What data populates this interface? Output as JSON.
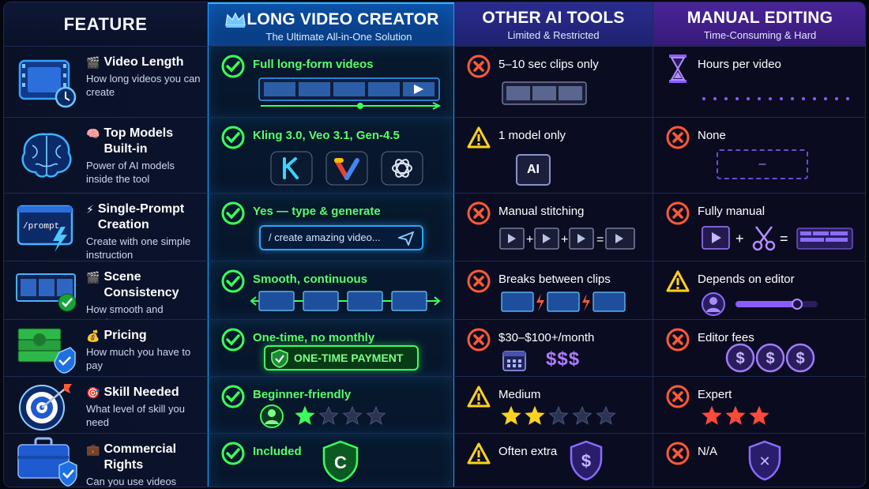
{
  "header": {
    "feature": "FEATURE",
    "long_title": "LONG VIDEO CREATOR",
    "long_sub": "The Ultimate All-in-One Solution",
    "other_title": "OTHER AI TOOLS",
    "other_sub": "Limited & Restricted",
    "manual_title": "MANUAL EDITING",
    "manual_sub": "Time-Consuming & Hard"
  },
  "rows": [
    {
      "feature": {
        "emoji": "🎬",
        "title": "Video Length",
        "desc": "How long videos you can create",
        "icon": "film-clock-icon"
      },
      "long": {
        "status": "check",
        "text": "Full long-form videos"
      },
      "other": {
        "status": "cross",
        "text": "5–10 sec clips only"
      },
      "manual": {
        "status": "hourglass",
        "text": "Hours per video"
      }
    },
    {
      "feature": {
        "emoji": "🧠",
        "title": "Top Models Built-in",
        "desc": "Power of AI models inside the tool",
        "icon": "brain-icon"
      },
      "long": {
        "status": "check",
        "text": "Kling 3.0, Veo 3.1, Gen-4.5"
      },
      "other": {
        "status": "warning",
        "text": "1 model only",
        "chip": "AI"
      },
      "manual": {
        "status": "cross",
        "text": "None",
        "placeholder": "–"
      }
    },
    {
      "feature": {
        "emoji": "⚡",
        "title": "Single-Prompt Creation",
        "desc": "Create with one simple instruction",
        "icon": "prompt-window-icon",
        "window_text": "/prompt"
      },
      "long": {
        "status": "check",
        "text": "Yes — type & generate",
        "prompt": "/ create amazing video..."
      },
      "other": {
        "status": "cross",
        "text": "Manual stitching"
      },
      "manual": {
        "status": "cross",
        "text": "Fully manual"
      }
    },
    {
      "feature": {
        "emoji": "🎬",
        "title": "Scene Consistency",
        "desc": "How smooth and continuous scenes are",
        "icon": "filmstrip-check-icon"
      },
      "long": {
        "status": "check",
        "text": "Smooth, continuous"
      },
      "other": {
        "status": "cross",
        "text": "Breaks between clips"
      },
      "manual": {
        "status": "warning",
        "text": "Depends on editor",
        "slider_level": 0.75
      }
    },
    {
      "feature": {
        "emoji": "💰",
        "title": "Pricing",
        "desc": "How much you have to pay",
        "icon": "money-shield-icon"
      },
      "long": {
        "status": "check",
        "text": "One-time, no monthly",
        "badge": "ONE-TIME PAYMENT"
      },
      "other": {
        "status": "cross",
        "text": "$30–$100+/month",
        "price_marks": "$$$"
      },
      "manual": {
        "status": "cross",
        "text": "Editor fees"
      }
    },
    {
      "feature": {
        "emoji": "🎯",
        "title": "Skill Needed",
        "desc": "What level of skill you need",
        "icon": "target-icon"
      },
      "long": {
        "status": "check",
        "text": "Beginner-friendly",
        "stars_filled": 1,
        "stars_total": 4
      },
      "other": {
        "status": "warning",
        "text": "Medium",
        "stars_filled": 2,
        "stars_total": 5
      },
      "manual": {
        "status": "cross",
        "text": "Expert",
        "stars_filled": 3,
        "stars_total": 3
      }
    },
    {
      "feature": {
        "emoji": "💼",
        "title": "Commercial Rights",
        "desc": "Can you use videos commercially?",
        "icon": "briefcase-shield-icon"
      },
      "long": {
        "status": "check",
        "text": "Included",
        "shield": "C"
      },
      "other": {
        "status": "warning",
        "text": "Often extra",
        "shield": "$"
      },
      "manual": {
        "status": "cross",
        "text": "N/A",
        "shield": "✕"
      }
    }
  ],
  "colors": {
    "long_accent": "#1aa0ff",
    "check": "#3cff5a",
    "cross": "#ff5a36",
    "warning": "#ffd21f",
    "purple": "#8a5cff"
  }
}
